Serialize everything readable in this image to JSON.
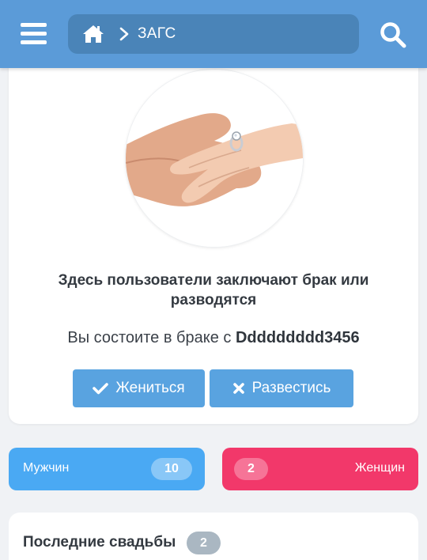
{
  "header": {
    "breadcrumb": {
      "home_icon": "home-icon",
      "separator_icon": "chevron-right-icon",
      "current": "ЗАГС"
    },
    "menu_icon": "hamburger-menu-icon",
    "search_icon": "search-icon"
  },
  "main": {
    "image_alt": "hands-with-ring-photo",
    "title": "Здесь пользователи заключают брак или разводятся",
    "status_prefix": "Вы состоите в браке с",
    "status_partner": "Ddddddddd3456",
    "buttons": {
      "marry": {
        "label": "Жениться",
        "icon": "check-icon"
      },
      "divorce": {
        "label": "Развестись",
        "icon": "close-icon"
      }
    }
  },
  "stats": {
    "men": {
      "label": "Мужчин",
      "count": "10"
    },
    "women": {
      "label": "Женщин",
      "count": "2"
    }
  },
  "recent": {
    "title": "Последние свадьбы",
    "count": "2"
  },
  "colors": {
    "header": "#5b9bd8",
    "breadcrumb_bg": "#4a84b8",
    "button": "#59a3e0",
    "men": "#4aa9f3",
    "women": "#f2386a",
    "badge_gray": "#aab7c2",
    "page_bg": "#f0f2f5"
  }
}
